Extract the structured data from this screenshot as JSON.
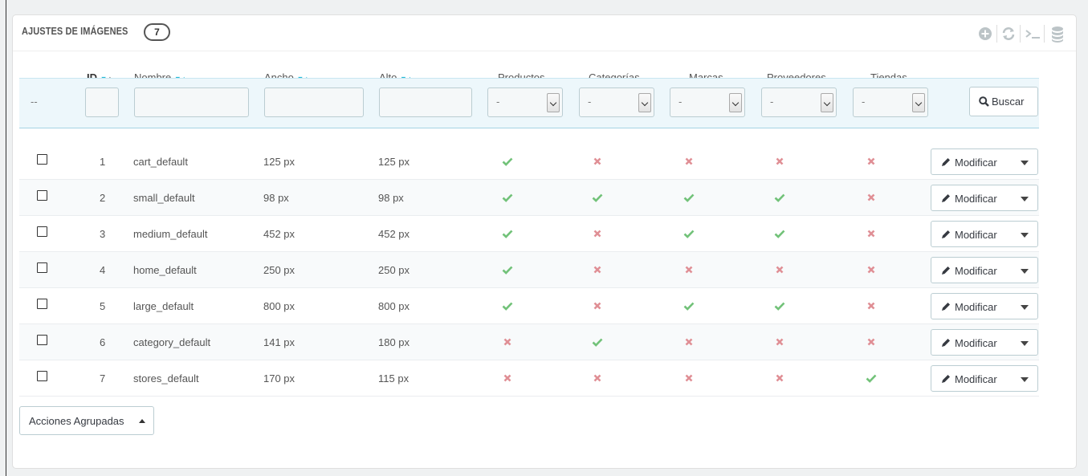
{
  "panel": {
    "title": "AJUSTES DE IMÁGENES",
    "count": "7",
    "toolbar_icons": [
      "add-icon",
      "refresh-icon",
      "sql-query-icon",
      "database-export-icon"
    ]
  },
  "columns": {
    "id": "ID",
    "name": "Nombre",
    "width": "Ancho",
    "height": "Alto",
    "products": "Productos",
    "categories": "Categorías",
    "brands": "Marcas",
    "suppliers": "Proveedores",
    "stores": "Tiendas"
  },
  "filters": {
    "dash": "--",
    "select_value": "-",
    "search_label": "Buscar"
  },
  "rows": [
    {
      "id": "1",
      "name": "cart_default",
      "width": "125 px",
      "height": "125 px",
      "products": true,
      "categories": false,
      "brands": false,
      "suppliers": false,
      "stores": false
    },
    {
      "id": "2",
      "name": "small_default",
      "width": "98 px",
      "height": "98 px",
      "products": true,
      "categories": true,
      "brands": true,
      "suppliers": true,
      "stores": false
    },
    {
      "id": "3",
      "name": "medium_default",
      "width": "452 px",
      "height": "452 px",
      "products": true,
      "categories": false,
      "brands": true,
      "suppliers": true,
      "stores": false
    },
    {
      "id": "4",
      "name": "home_default",
      "width": "250 px",
      "height": "250 px",
      "products": true,
      "categories": false,
      "brands": false,
      "suppliers": false,
      "stores": false
    },
    {
      "id": "5",
      "name": "large_default",
      "width": "800 px",
      "height": "800 px",
      "products": true,
      "categories": false,
      "brands": true,
      "suppliers": true,
      "stores": false
    },
    {
      "id": "6",
      "name": "category_default",
      "width": "141 px",
      "height": "180 px",
      "products": false,
      "categories": true,
      "brands": false,
      "suppliers": false,
      "stores": false
    },
    {
      "id": "7",
      "name": "stores_default",
      "width": "170 px",
      "height": "115 px",
      "products": false,
      "categories": false,
      "brands": false,
      "suppliers": false,
      "stores": true
    }
  ],
  "row_action_label": "Modificar",
  "bulk_actions_label": "Acciones Agrupadas",
  "colors": {
    "check": "#72c279",
    "cross": "#e08f95",
    "accent": "#25b9d7",
    "filter_bg": "#edf7fb"
  }
}
